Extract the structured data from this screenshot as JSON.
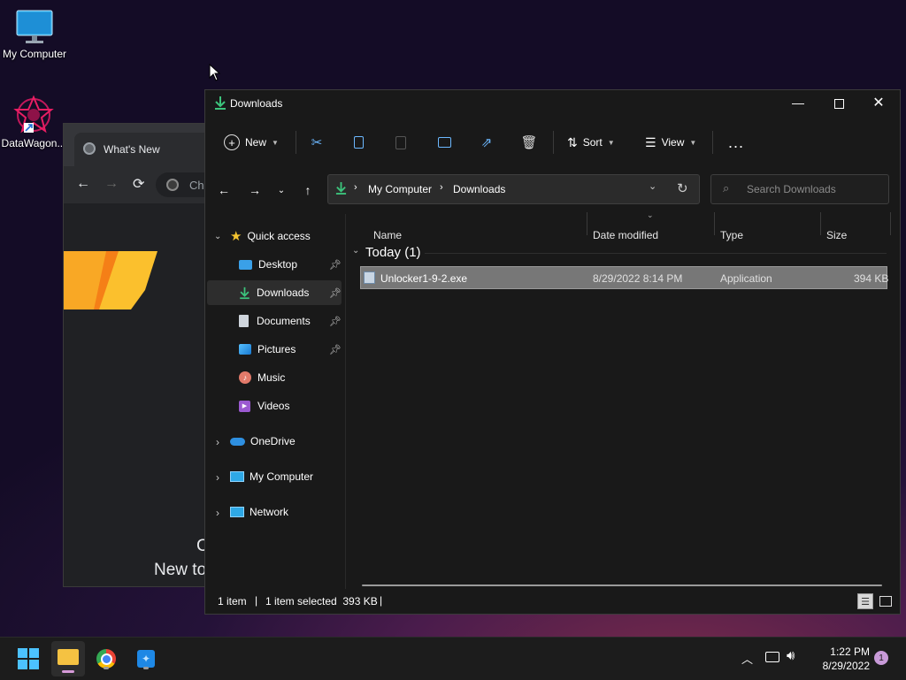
{
  "desktop": {
    "icons": [
      {
        "label": "My Computer",
        "icon": "monitor-icon"
      },
      {
        "label": "DataWagon...",
        "icon": "datawagon-shortcut-icon"
      }
    ]
  },
  "browser": {
    "tab_title": "What's New",
    "address_partial": "Ch",
    "content_partial_1": "C",
    "content_partial_2": "New to"
  },
  "explorer": {
    "title": "Downloads",
    "window_controls": {
      "minimize": "—",
      "maximize": "☐",
      "close": "✕"
    },
    "commands": {
      "new_label": "New",
      "sort_label": "Sort",
      "view_label": "View",
      "more_label": "..."
    },
    "address": {
      "crumbs": [
        "My Computer",
        "Downloads"
      ],
      "search_placeholder": "Search Downloads"
    },
    "sidebar": {
      "quick_access": "Quick access",
      "items": [
        {
          "label": "Desktop",
          "icon": "desktop-folder-icon",
          "pinned": true
        },
        {
          "label": "Downloads",
          "icon": "downloads-icon",
          "pinned": true,
          "selected": true
        },
        {
          "label": "Documents",
          "icon": "documents-icon",
          "pinned": true
        },
        {
          "label": "Pictures",
          "icon": "pictures-icon",
          "pinned": true
        },
        {
          "label": "Music",
          "icon": "music-icon"
        },
        {
          "label": "Videos",
          "icon": "videos-icon"
        }
      ],
      "roots": [
        {
          "label": "OneDrive",
          "icon": "onedrive-icon"
        },
        {
          "label": "My Computer",
          "icon": "computer-icon"
        },
        {
          "label": "Network",
          "icon": "network-icon"
        }
      ]
    },
    "columns": {
      "name": "Name",
      "date": "Date modified",
      "type": "Type",
      "size": "Size"
    },
    "group": {
      "label": "Today (1)"
    },
    "files": [
      {
        "name": "Unlocker1-9-2.exe",
        "date": "8/29/2022 8:14 PM",
        "type": "Application",
        "size": "394 KB"
      }
    ],
    "status": {
      "count": "1 item",
      "selected": "1 item selected  393 KB",
      "sep": "|"
    }
  },
  "taskbar": {
    "clock_time": "1:22 PM",
    "clock_date": "8/29/2022",
    "notification_count": "1"
  },
  "colors": {
    "accent": "#60cdff",
    "explorer_bg": "#191919",
    "taskbar_bg": "#1c1c1c",
    "selection": "#777777"
  }
}
